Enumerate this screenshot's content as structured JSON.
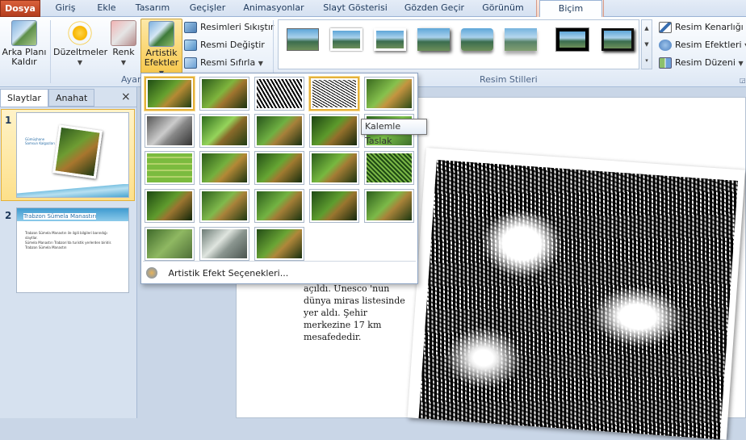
{
  "tabs": [
    {
      "label": "Dosya"
    },
    {
      "label": "Giriş"
    },
    {
      "label": "Ekle"
    },
    {
      "label": "Tasarım"
    },
    {
      "label": "Geçişler"
    },
    {
      "label": "Animasyonlar"
    },
    {
      "label": "Slayt Gösterisi"
    },
    {
      "label": "Gözden Geçir"
    },
    {
      "label": "Görünüm"
    },
    {
      "label": "Biçim"
    }
  ],
  "ribbon": {
    "remove_bg": "Arka Planı\nKaldır",
    "corrections": "Düzeltmeler",
    "color": "Renk",
    "artistic": "Artistik\nEfektler",
    "compress": "Resimleri Sıkıştır",
    "change": "Resmi Değiştir",
    "reset": "Resmi Sıfırla",
    "adjust_group": "Ayar",
    "styles_group": "Resim Stilleri",
    "border": "Resim Kenarlığı",
    "effects": "Resim Efektleri",
    "layout": "Resim Düzeni"
  },
  "pane": {
    "tab_slides": "Slaytlar",
    "tab_outline": "Anahat",
    "close": "×",
    "slide1_num": "1",
    "slide2_num": "2",
    "slide1_title": "Gümüşhane Samsun Kalgazları",
    "slide2_title": "Trabzon Sümela Manastırı",
    "slide2_bullets": [
      "Trabzon Sümela Manastırı ile ilgili bilgileri barındığı slaytlar.",
      "Sümela Manastırı Trabzon'da turistik yerlerden biridir.",
      "Trabzon Sümela Manastırı"
    ]
  },
  "slide": {
    "text": "açıldı. Unesco 'nun dünya miras listesinde yer aldı. Şehir merkezine 17 km mesafededir."
  },
  "gallery": {
    "options_label": "Artistik Efekt Seçenekleri...",
    "tooltip": "Kalemle Taslak"
  },
  "colors": {
    "file_tab": "#c94d2b",
    "accent": "#e4b13b",
    "ribbon_text": "#1e395b"
  }
}
